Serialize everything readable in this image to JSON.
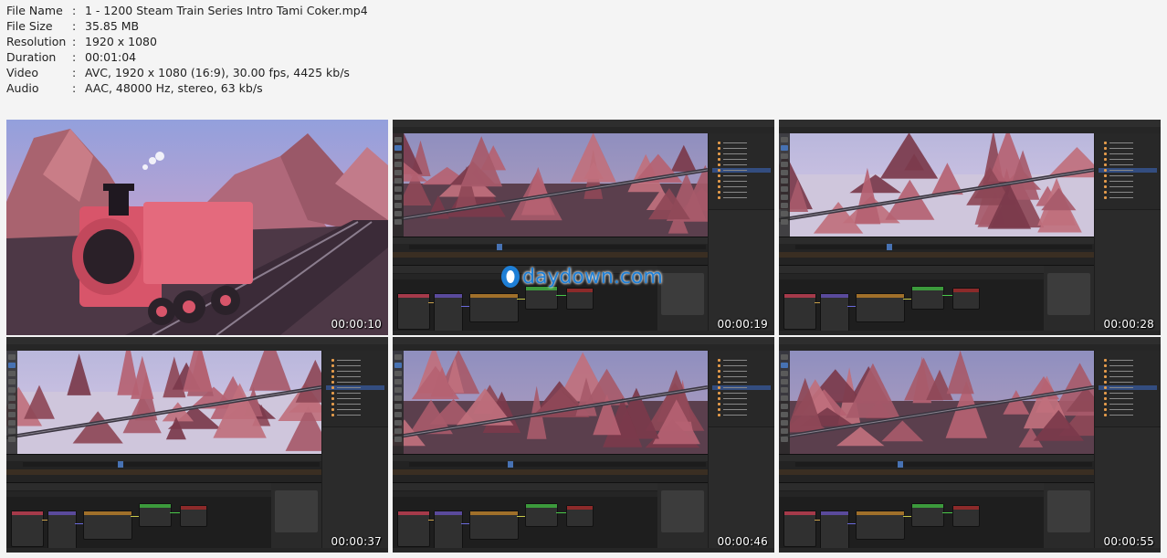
{
  "file_info": [
    {
      "key": "File Name",
      "value": "1 - 1200 Steam Train Series Intro Tami Coker.mp4"
    },
    {
      "key": "File Size",
      "value": "35.85 MB"
    },
    {
      "key": "Resolution",
      "value": "1920 x 1080"
    },
    {
      "key": "Duration",
      "value": "00:01:04"
    },
    {
      "key": "Video",
      "value": "AVC, 1920 x 1080 (16:9), 30.00 fps, 4425 kb/s"
    },
    {
      "key": "Audio",
      "value": "AAC, 48000 Hz, stereo, 63 kb/s"
    }
  ],
  "separator": ":",
  "watermark": "daydown.com",
  "thumbnails": [
    {
      "timestamp": "00:00:10"
    },
    {
      "timestamp": "00:00:19"
    },
    {
      "timestamp": "00:00:28"
    },
    {
      "timestamp": "00:00:37"
    },
    {
      "timestamp": "00:00:46"
    },
    {
      "timestamp": "00:00:55"
    }
  ],
  "colors": {
    "page_bg": "#f4f4f4",
    "blender_bg": "#1d1d1d",
    "accent_blue": "#4772b3",
    "watermark_blue": "#1e7fd6",
    "train_red": "#e35a6e"
  }
}
